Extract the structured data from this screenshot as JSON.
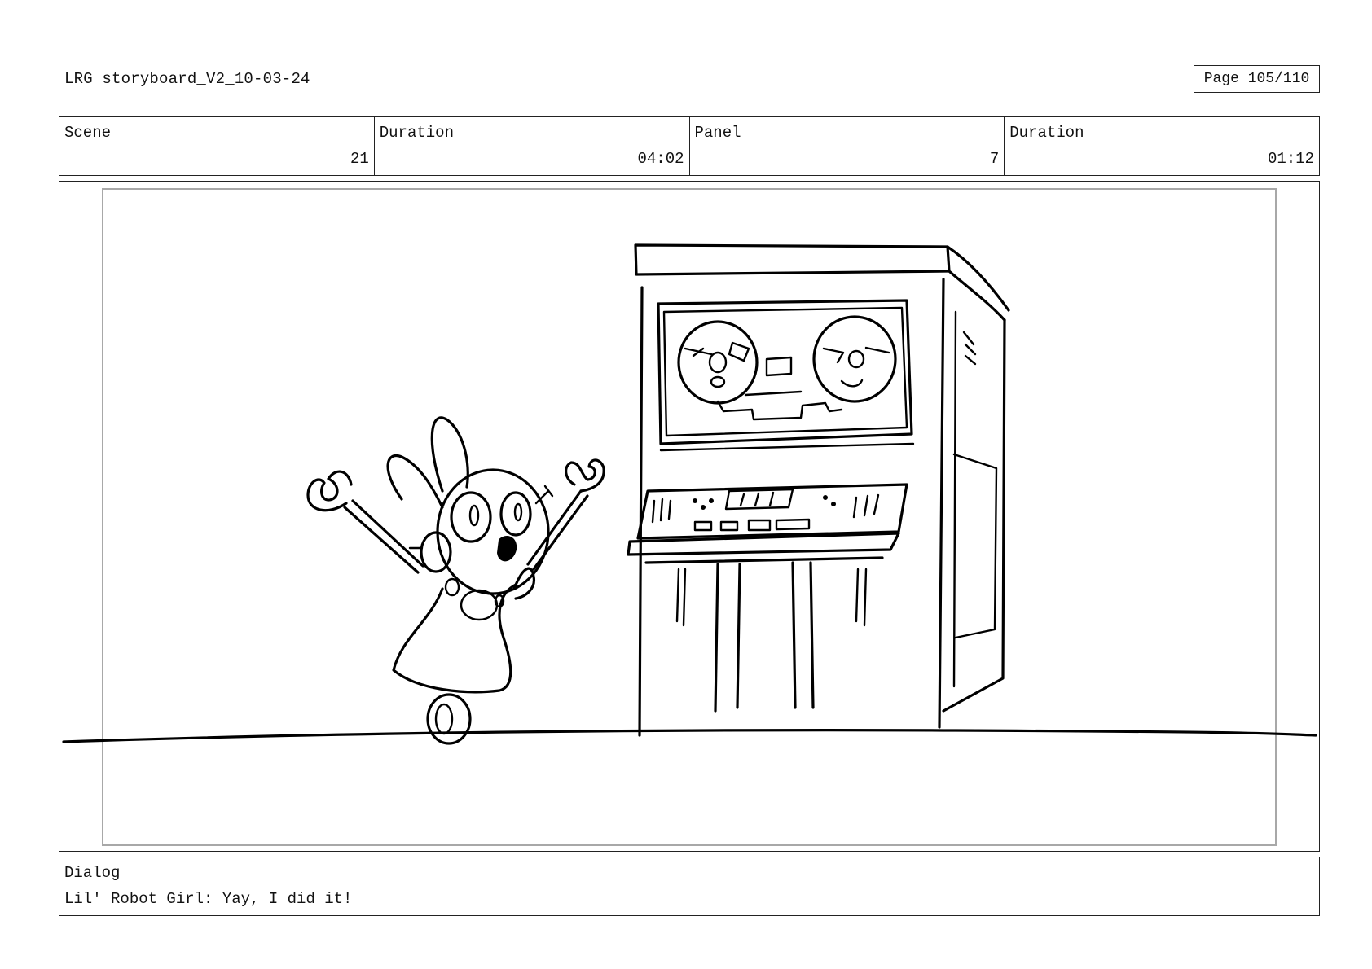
{
  "header": {
    "doc_title": "LRG storyboard_V2_10-03-24",
    "page_label": "Page 105/110"
  },
  "info": {
    "scene_label": "Scene",
    "scene_value": "21",
    "scene_duration_label": "Duration",
    "scene_duration_value": "04:02",
    "panel_label": "Panel",
    "panel_value": "7",
    "panel_duration_label": "Duration",
    "panel_duration_value": "01:12"
  },
  "dialog": {
    "label": "Dialog",
    "text": "Lil' Robot Girl: Yay, I did it!"
  }
}
